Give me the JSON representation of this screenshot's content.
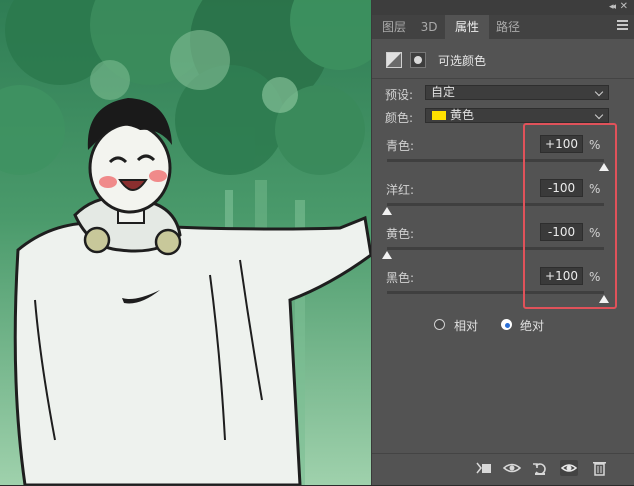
{
  "panel": {
    "tabs": [
      {
        "label": "图层"
      },
      {
        "label": "3D"
      },
      {
        "label": "属性"
      },
      {
        "label": "路径"
      }
    ],
    "collapse_glyph": "◂◂",
    "close_glyph": "✕",
    "title": "可选颜色",
    "preset": {
      "label": "预设:",
      "value": "自定"
    },
    "colors": {
      "label": "颜色:",
      "value": "黄色",
      "swatch_color": "#ffe100"
    },
    "sliders": [
      {
        "label": "青色:",
        "value": "+100",
        "unit": "%",
        "level_percent": 100
      },
      {
        "label": "洋红:",
        "value": "-100",
        "unit": "%",
        "level_percent": 0
      },
      {
        "label": "黄色:",
        "value": "-100",
        "unit": "%",
        "level_percent": 0
      },
      {
        "label": "黑色:",
        "value": "+100",
        "unit": "%",
        "level_percent": 100
      }
    ],
    "method": {
      "options": [
        {
          "label": "相对",
          "checked": false
        },
        {
          "label": "绝对",
          "checked": true
        }
      ]
    },
    "highlight_color": "#e0525a",
    "footer_icons": [
      "clip-to-layer-icon",
      "view-previous-state-icon",
      "reset-icon",
      "visibility-eye-icon",
      "trash-icon"
    ]
  }
}
